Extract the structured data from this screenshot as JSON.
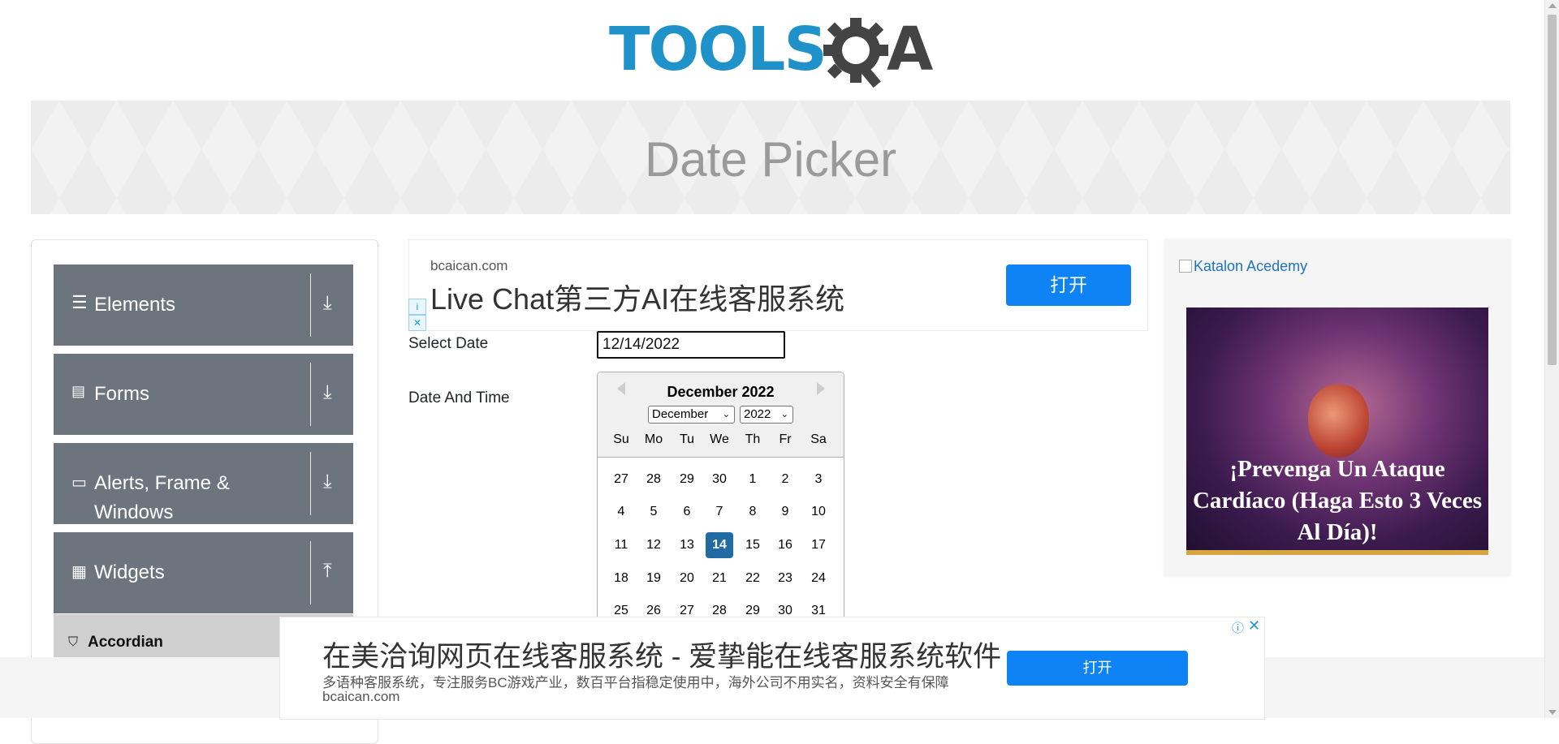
{
  "header": {
    "logo_text": "TOOLS",
    "logo_text_end": "A"
  },
  "page": {
    "title": "Date Picker"
  },
  "sidebar": {
    "groups": [
      {
        "label": "Elements",
        "icon": "hamburger-icon",
        "arrow": "download-arrow-icon"
      },
      {
        "label": "Forms",
        "icon": "form-icon",
        "arrow": "download-arrow-icon"
      },
      {
        "label": "Alerts, Frame & Windows",
        "icon": "window-icon",
        "arrow": "download-arrow-icon"
      },
      {
        "label": "Widgets",
        "icon": "widgets-icon",
        "arrow": "upload-arrow-icon"
      }
    ],
    "active_item": {
      "label": "Accordian",
      "icon": "html5-icon"
    }
  },
  "top_ad": {
    "domain": "bcaican.com",
    "headline": "Live Chat第三方AI在线客服系统",
    "button": "打开"
  },
  "form": {
    "select_date_label": "Select Date",
    "select_date_value": "12/14/2022",
    "date_time_label": "Date And Time"
  },
  "datepicker": {
    "current_month": "December 2022",
    "month_select": "December",
    "year_select": "2022",
    "weekdays": [
      "Su",
      "Mo",
      "Tu",
      "We",
      "Th",
      "Fr",
      "Sa"
    ],
    "weeks": [
      [
        "27",
        "28",
        "29",
        "30",
        "1",
        "2",
        "3"
      ],
      [
        "4",
        "5",
        "6",
        "7",
        "8",
        "9",
        "10"
      ],
      [
        "11",
        "12",
        "13",
        "14",
        "15",
        "16",
        "17"
      ],
      [
        "18",
        "19",
        "20",
        "21",
        "22",
        "23",
        "24"
      ],
      [
        "25",
        "26",
        "27",
        "28",
        "29",
        "30",
        "31"
      ]
    ],
    "selected_day": "14"
  },
  "right_ad": {
    "alt_text": "Katalon Acedemy",
    "caption": "¡Prevenga Un Ataque Cardíaco (Haga Esto 3 Veces Al Día)!"
  },
  "bottom_ad": {
    "headline": "在美洽询网页在线客服系统 - 爱挚能在线客服系统软件",
    "subtext": "多语种客服系统，专注服务BC游戏产业，数百平台指稳定使用中，海外公司不用实名，资料安全有保障",
    "domain": "bcaican.com",
    "button": "打开",
    "info": "ⓘ",
    "close": "✕"
  },
  "colors": {
    "brand_blue": "#1f93c9",
    "sidebar_gray": "#6c757d",
    "selected_day": "#216ba5",
    "ad_button": "#0d83f5"
  }
}
